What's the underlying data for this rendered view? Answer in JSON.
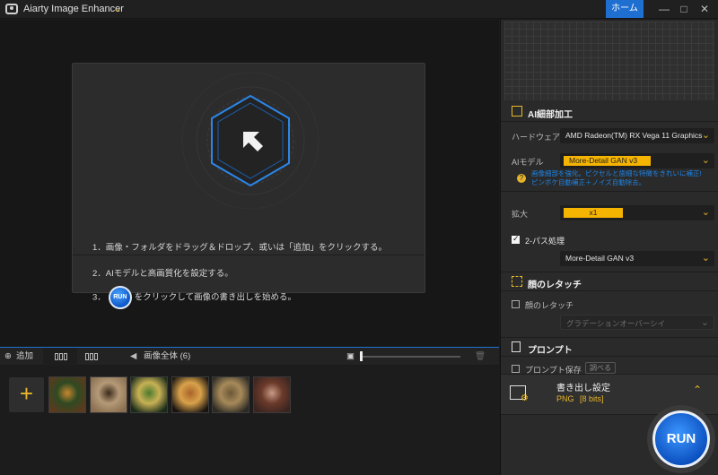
{
  "window": {
    "title": "Aiarty Image Enhancer",
    "home_label": "ホーム",
    "minimize": "—",
    "maximize": "□",
    "close": "✕"
  },
  "preview": {
    "steps": [
      "1．画像・フォルダをドラッグ＆ドロップ、或いは「追加」をクリックする。",
      "2．AIモデルと高画質化を設定する。",
      "3．",
      "をクリックして画像の書き出しを始める。"
    ],
    "run_mini_label": "RUN"
  },
  "thumbbar": {
    "add_label": "追加",
    "whole_image_label": "画像全体 (6)"
  },
  "thumbnails": [
    {
      "name": "tiger",
      "colors": [
        "#5b3a1e",
        "#c7862f",
        "#2f4a22"
      ]
    },
    {
      "name": "butterfly",
      "colors": [
        "#8a6f50",
        "#3c2a1a",
        "#b59a78"
      ]
    },
    {
      "name": "forest",
      "colors": [
        "#1a2b1a",
        "#4b7a2c",
        "#c8b155"
      ]
    },
    {
      "name": "burger",
      "colors": [
        "#1a1410",
        "#a9642a",
        "#d9a24a"
      ]
    },
    {
      "name": "warrior",
      "colors": [
        "#2c2a24",
        "#6b5636",
        "#a78a5a"
      ]
    },
    {
      "name": "woman",
      "colors": [
        "#3a2420",
        "#c99a86",
        "#6b3a2a"
      ]
    }
  ],
  "panel": {
    "ai_section": {
      "title": "AI細部加工",
      "hardware_label": "ハードウェア",
      "hardware_value": "AMD Radeon(TM) RX Vega 11 Graphics",
      "model_label": "AIモデル",
      "model_value": "More-Detail GAN  v3",
      "model_desc_1": "画像細部を強化。ピクセルと歯細な特徴をきれいに補正!",
      "model_desc_2": "ピンボケ自動補正＋ノイズ自動除去。",
      "scale_label": "拡大",
      "scale_value": "x1",
      "twopass_label": "2-パス処理",
      "twopass_checked": true,
      "twopass_value": "More-Detail GAN  v3"
    },
    "face_section": {
      "title": "顔のレタッチ",
      "checkbox_label": "顔のレタッチ",
      "select_value": "グラデーションオーバーシイ"
    },
    "prompt_section": {
      "title": "プロンプト",
      "save_label": "プロンプト保存",
      "edit_label": "調べる"
    },
    "export": {
      "title": "書き出し設定",
      "format": "PNG",
      "bits": "[8 bits]"
    },
    "run_label": "RUN"
  },
  "colors": {
    "accent_blue": "#1f6fd1",
    "accent_yellow": "#f4b400",
    "bg": "#1b1b1b",
    "panel": "#2a2a2a"
  }
}
